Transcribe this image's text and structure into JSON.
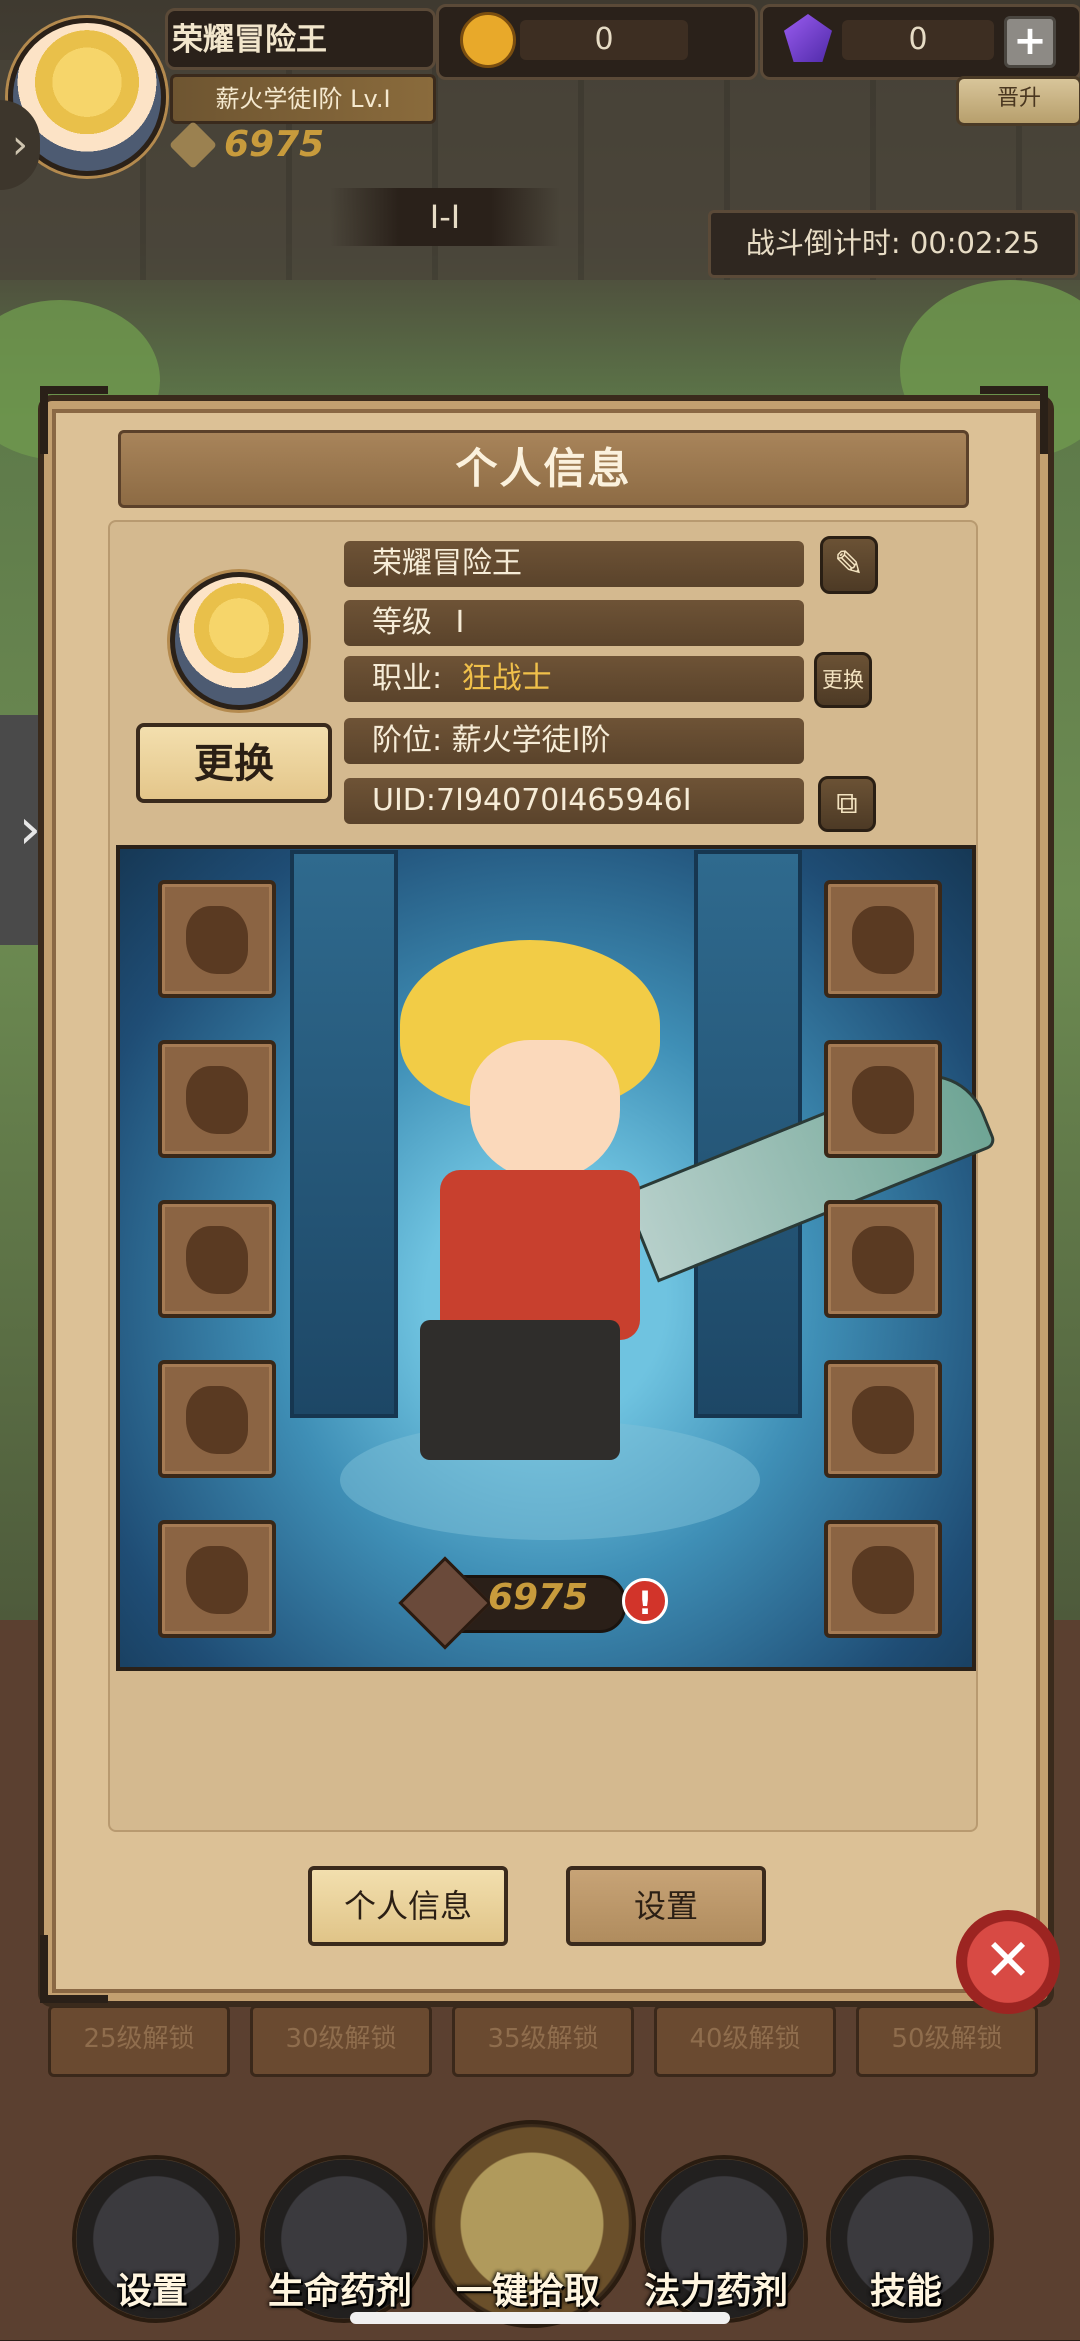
{
  "header": {
    "player_name": "荣耀冒险王",
    "rank_badge": "薪火学徒Ⅰ阶 Lv.Ⅰ",
    "combat_power": "6975",
    "gold": "0",
    "gems": "0",
    "upgrade_label": "晋升",
    "stage": "Ⅰ-Ⅰ",
    "battle_timer": "战斗倒计时: 00:02:25"
  },
  "panel": {
    "title": "个人信息",
    "change_avatar": "更换",
    "name": "荣耀冒险王",
    "level_label": "等级",
    "level_value": "Ⅰ",
    "class_label": "职业:",
    "class_value": "狂战士",
    "class_change": "更换",
    "rank": "阶位: 薪火学徒Ⅰ阶",
    "uid": "UID:7Ⅰ94070Ⅰ465946Ⅰ",
    "power": "6975",
    "tabs": [
      "个人信息",
      "设置"
    ]
  },
  "background": {
    "locks": [
      "25级解锁",
      "30级解锁",
      "35级解锁",
      "40级解锁",
      "50级解锁"
    ]
  },
  "bottom_nav": [
    "设置",
    "生命药剂",
    "一键拾取",
    "法力药剂",
    "技能"
  ],
  "colors": {
    "accent": "#f2cc46",
    "panel": "#dcc196",
    "close": "#c93a3a",
    "class": "#f0c04a"
  }
}
